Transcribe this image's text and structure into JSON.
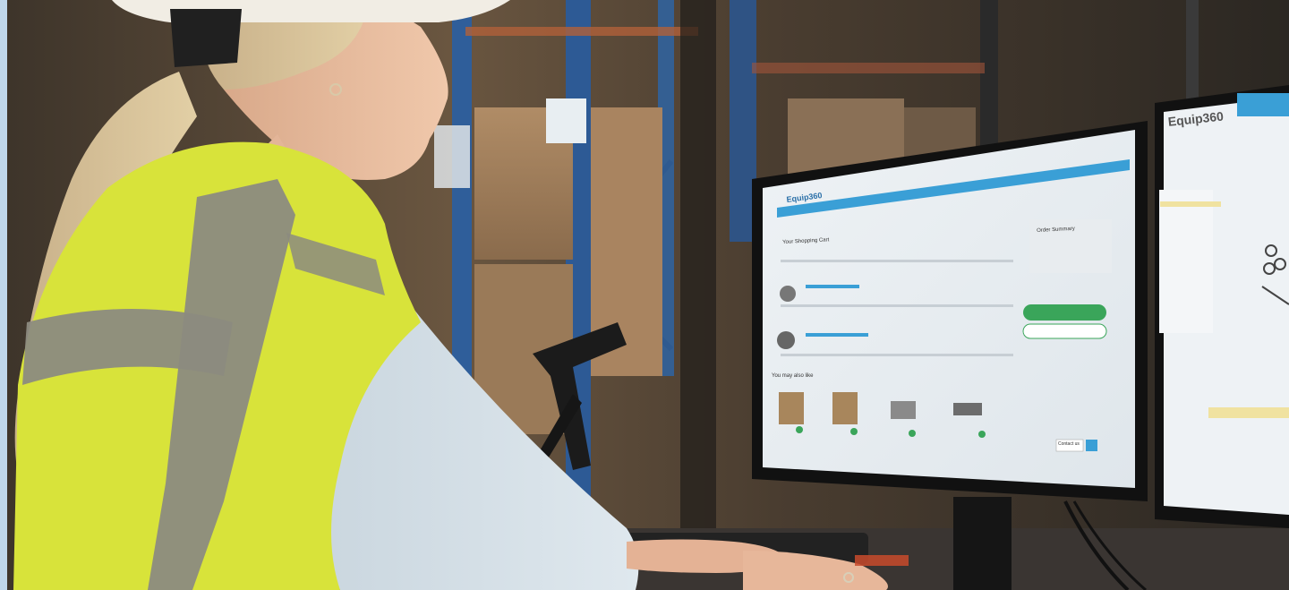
{
  "photo": {
    "subject": "warehouse worker at computer"
  },
  "monitor_main": {
    "brand": "Equip360",
    "page_title": "Your Shopping Cart",
    "summary_title": "Order Summary",
    "section_title": "You may also like",
    "contact_label": "Contact us"
  },
  "monitor_side": {
    "brand": "Equip360"
  },
  "colors": {
    "accent": "#3a9fd6",
    "green": "#3aa55a",
    "vest": "#d8e33a",
    "reflective": "#8c8b80"
  }
}
